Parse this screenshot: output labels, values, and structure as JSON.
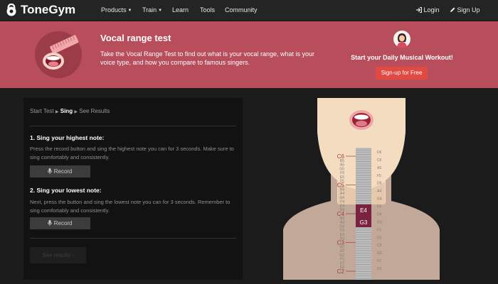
{
  "nav": {
    "brand": "ToneGym",
    "items": [
      "Products",
      "Train",
      "Learn",
      "Tools",
      "Community"
    ],
    "login": "Login",
    "signup": "Sign Up"
  },
  "banner": {
    "title": "Vocal range test",
    "description": "Take the Vocal Range Test to find out what is your vocal range, what is your voice type, and how you compare to famous singers.",
    "cta_text": "Start your Daily Musical Workout!",
    "cta_button": "Sign-up for Free"
  },
  "steps": {
    "crumb_start": "Start Test",
    "crumb_sing": "Sing",
    "crumb_results": "See Results",
    "step1_title": "1. Sing your highest note:",
    "step1_text": "Press the record button and sing the highest note you can for 3 seconds. Make sure to sing comfortably and consistently.",
    "step2_title": "2. Sing your lowest note:",
    "step2_text": "Next, press the button and sing the lowest note you can for 3 seconds. Remember to sing comfortably and consistently.",
    "record_label": "Record",
    "see_results_label": "See results"
  },
  "piano": {
    "left_labels": [
      "C6",
      "B5",
      "A5",
      "G5",
      "F5",
      "E5",
      "D5",
      "C5",
      "B4",
      "A4",
      "G4",
      "F4",
      "E4",
      "D4",
      "C4",
      "B3",
      "A3",
      "G3",
      "F3",
      "E3",
      "D3",
      "C3",
      "B2",
      "A2",
      "G2",
      "F2",
      "E2",
      "D2",
      "C2"
    ],
    "right_labels": [
      "D6",
      "C6",
      "A5",
      "F5",
      "D5",
      "A4",
      "G4",
      "F4",
      "D4",
      "G3",
      "F3",
      "D3",
      "C3",
      "G2",
      "F2",
      "D2"
    ],
    "highlight_high": "E4",
    "highlight_low": "G3"
  },
  "colors": {
    "banner": "#b84d5b",
    "cta_button": "#e04a43",
    "highlight": "#7a2240",
    "skin": "#f4dcc0"
  }
}
